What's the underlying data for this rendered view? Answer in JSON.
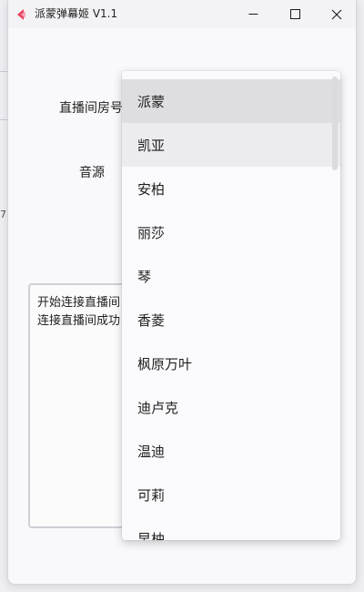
{
  "window": {
    "title": "派蒙弹幕姬 V1.1",
    "logo": "app-logo-icon",
    "controls": [
      "minimize-icon",
      "maximize-icon",
      "close-icon"
    ]
  },
  "form": {
    "room_label": "直播间房号",
    "voice_label": "音源"
  },
  "log": {
    "lines": [
      "开始连接直播间",
      "连接直播间成功"
    ]
  },
  "dropdown": {
    "selected": "派蒙",
    "hovered": "凯亚",
    "options": [
      "派蒙",
      "凯亚",
      "安柏",
      "丽莎",
      "琴",
      "香菱",
      "枫原万叶",
      "迪卢克",
      "温迪",
      "可莉",
      "早柚"
    ]
  },
  "background": {
    "edge_text": "7"
  },
  "colors": {
    "logo_red": "#e8435f",
    "logo_pink": "#f6a6b6",
    "selected_bg": "#dedee2",
    "hover_bg": "#ececf0"
  }
}
